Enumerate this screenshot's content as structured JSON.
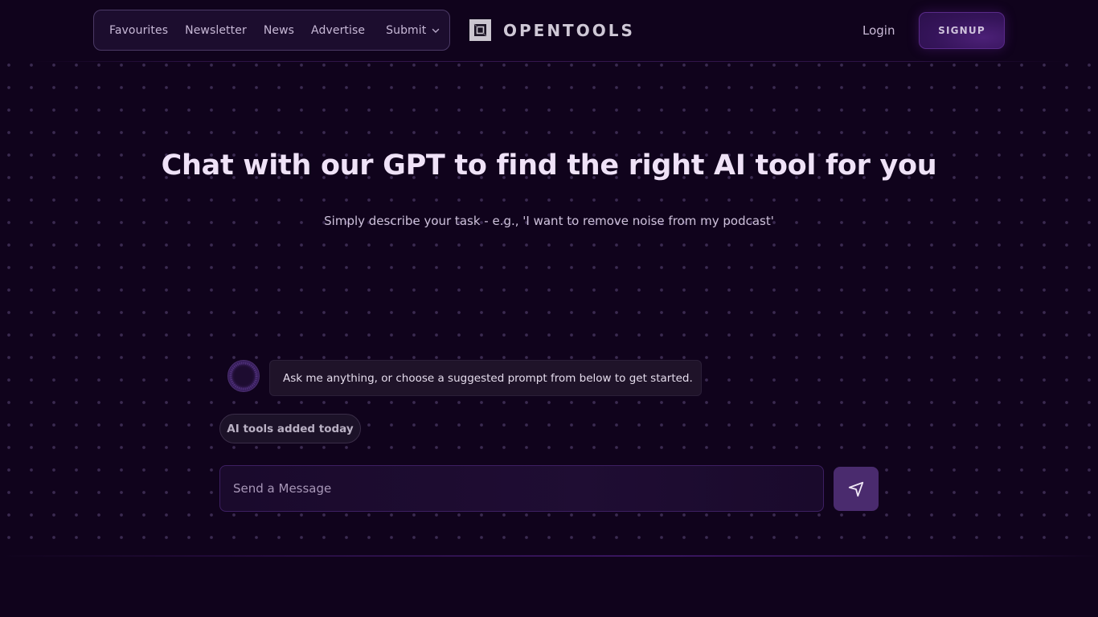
{
  "nav": {
    "items": [
      {
        "label": "Favourites"
      },
      {
        "label": "Newsletter"
      },
      {
        "label": "News"
      },
      {
        "label": "Advertise"
      },
      {
        "label": "Submit",
        "icon": "chevron-down-icon"
      }
    ]
  },
  "brand": {
    "name": "OPENTOOLS",
    "icon": "opentools-logo-icon"
  },
  "auth": {
    "login_label": "Login",
    "signup_label": "SIGNUP"
  },
  "hero": {
    "title": "Chat with our GPT to find the right AI tool for you",
    "subtitle": "Simply describe your task - e.g., 'I want to remove noise from my podcast'"
  },
  "chat": {
    "assistant_message": "Ask me anything, or choose a suggested prompt from below to get started.",
    "suggested_prompts": [
      {
        "label": "AI tools added today"
      }
    ],
    "input": {
      "value": "",
      "placeholder": "Send a Message"
    },
    "send_icon": "send-icon"
  },
  "colors": {
    "background": "#10031c",
    "accent": "#4a2b6e",
    "signup_bg": "#35145a"
  }
}
